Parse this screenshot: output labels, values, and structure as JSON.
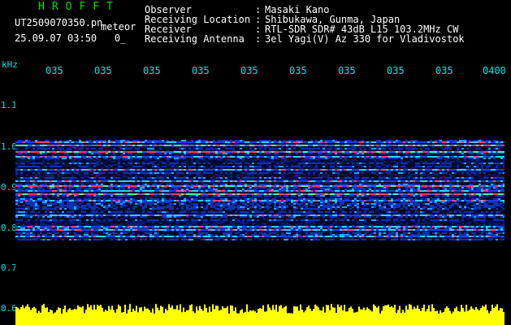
{
  "header": {
    "logo": "HROFFT",
    "filename": "UT2509070350.pn",
    "meteor_label": "meteor",
    "datetime": "25.09.07 03:50   0_",
    "rows": [
      {
        "label": "Observer",
        "value": "Masaki Kano"
      },
      {
        "label": "Receiving Location",
        "value": "Shibukawa, Gunma, Japan"
      },
      {
        "label": "Receiver",
        "value": "RTL-SDR SDR# 43dB L15 103.2MHz CW"
      },
      {
        "label": "Receiving Antenna",
        "value": "3el Yagi(V) Az 330 for Vladivostok"
      }
    ],
    "separator": ":"
  },
  "axis": {
    "y_unit": "kHz",
    "y_ticks": [
      "1.1",
      "1.0",
      "0.9",
      "0.8",
      "0.7",
      "0.6"
    ],
    "x_ticks": [
      "035",
      "035",
      "035",
      "035",
      "035",
      "035",
      "035",
      "035",
      "035",
      "0400"
    ]
  },
  "colors": {
    "label_text": "#ffffff",
    "axis_text": "#00e5e5",
    "logo_text": "#00e000",
    "noise_band": "#ffff00",
    "background": "#000000"
  }
}
